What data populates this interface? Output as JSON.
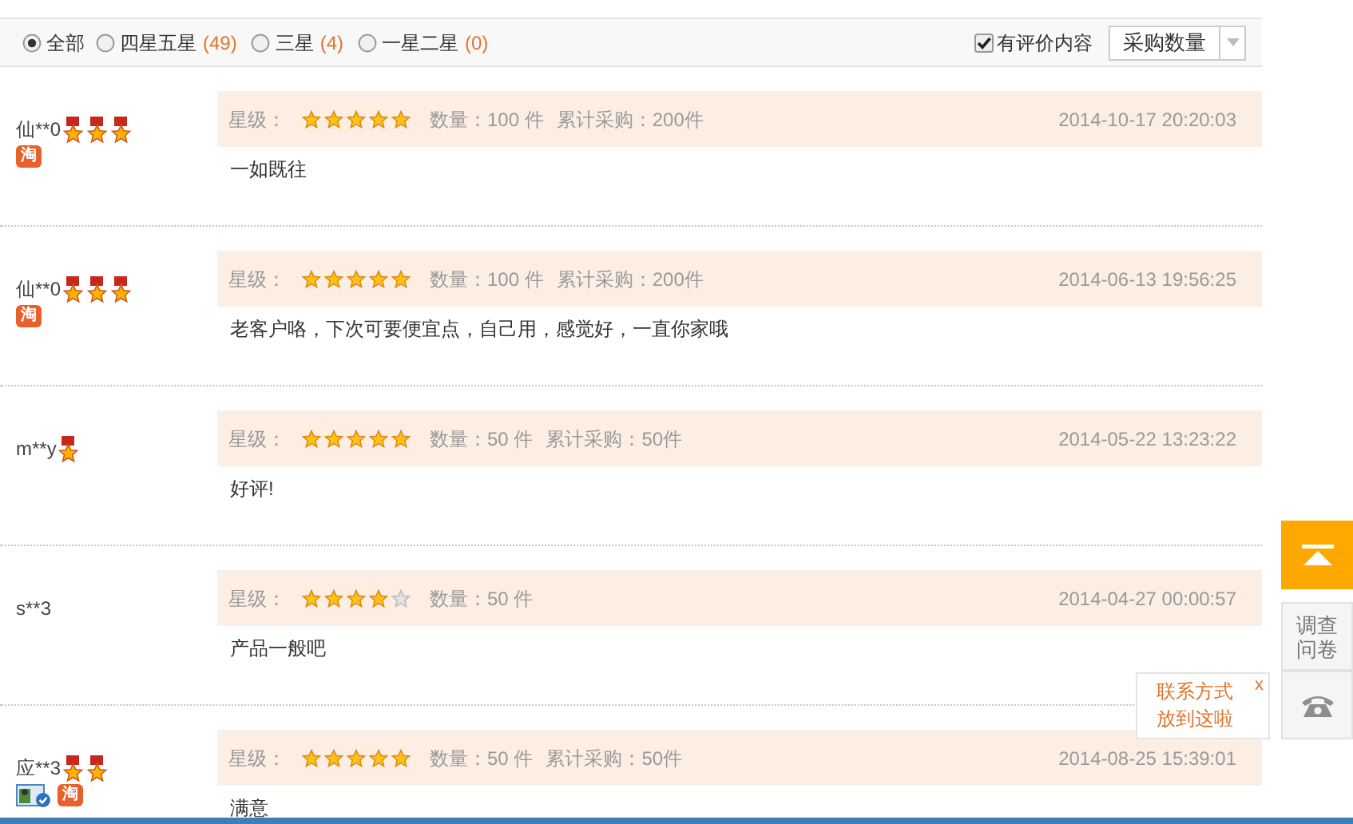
{
  "filter_bar": {
    "options": [
      {
        "label": "全部",
        "selected": true
      },
      {
        "label": "四星五星",
        "count": "(49)",
        "selected": false
      },
      {
        "label": "三星",
        "count": "(4)",
        "selected": false
      },
      {
        "label": "一星二星",
        "count": "(0)",
        "selected": false
      }
    ],
    "has_content": {
      "label": "有评价内容",
      "checked": true
    },
    "sort": {
      "value": "采购数量"
    }
  },
  "reviews": [
    {
      "user": "仙**0",
      "medals": [
        {
          "kind": "medal"
        },
        {
          "kind": "medal"
        },
        {
          "kind": "medal"
        }
      ],
      "badges": [
        {
          "kind": "tao",
          "label": "淘"
        }
      ],
      "rating_label": "星级：",
      "rating": {
        "stars": 5
      },
      "quantity": "数量：100 件",
      "total": "累计采购：200件",
      "date": "2014-10-17 20:20:03",
      "comment": "一如既往"
    },
    {
      "user": "仙**0",
      "medals": [
        {
          "kind": "medal"
        },
        {
          "kind": "medal"
        },
        {
          "kind": "medal"
        }
      ],
      "badges": [
        {
          "kind": "tao",
          "label": "淘"
        }
      ],
      "rating_label": "星级：",
      "rating": {
        "stars": 5
      },
      "quantity": "数量：100 件",
      "total": "累计采购：200件",
      "date": "2014-06-13 19:56:25",
      "comment": "老客户咯，下次可要便宜点，自己用，感觉好，一直你家哦"
    },
    {
      "user": "m**y",
      "medals": [
        {
          "kind": "medal"
        }
      ],
      "rating_label": "星级：",
      "rating": {
        "stars": 5
      },
      "quantity": "数量：50 件",
      "total": "累计采购：50件",
      "date": "2014-05-22 13:23:22",
      "comment": "好评!"
    },
    {
      "user": "s**3",
      "rating_label": "星级：",
      "rating": {
        "stars": 4
      },
      "quantity": "数量：50 件",
      "date": "2014-04-27 00:00:57",
      "comment": "产品一般吧"
    },
    {
      "user": "应**3",
      "medals": [
        {
          "kind": "medal"
        },
        {
          "kind": "medal"
        }
      ],
      "badges": [
        {
          "kind": "verified"
        },
        {
          "kind": "tao",
          "label": "淘"
        }
      ],
      "rating_label": "星级：",
      "rating": {
        "stars": 5
      },
      "quantity": "数量：50 件",
      "total": "累计采购：50件",
      "date": "2014-08-25 15:39:01",
      "comment": "满意"
    }
  ],
  "side_tools": {
    "survey": "调查问卷",
    "contact_tip": {
      "text": "联系方式放到这啦",
      "close": "x"
    }
  }
}
